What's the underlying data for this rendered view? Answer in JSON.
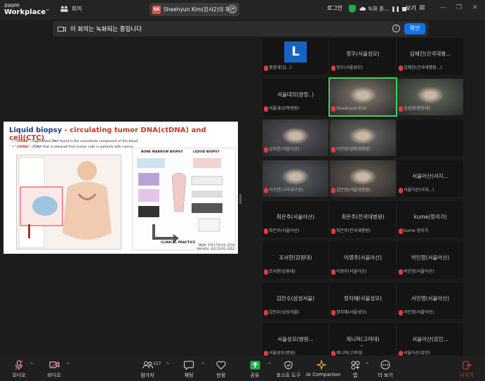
{
  "app": {
    "logo_line1": "zoom",
    "logo_line2": "Workplace"
  },
  "topbar": {
    "meeting_label": "회의",
    "share_initials": "SK",
    "share_title": "Sheehyun Kim(강사2)의 화면",
    "login_label": "로그인",
    "recording_label": "녹화 중...",
    "view_label": "보기"
  },
  "notice": {
    "text": "이 회의는 녹화되는 중입니다",
    "ok_label": "확인"
  },
  "slide": {
    "title_main": "Liquid biopsy",
    "title_sub": " - circulating tumor DNA(ctDNA) and cell(CTC)",
    "bullets": [
      {
        "term": "\"cfDNA\"",
        "text": ": fragmented DNA found in the noncellular component of the blood"
      },
      {
        "term": "\"ctDNA\"",
        "text": ": cfDNA that is released from tumor cells in patients with cancer"
      }
    ],
    "right_panel": {
      "left_heading": "BONE MARROW BIOPSY",
      "right_heading": "LIQUID BIOPSY",
      "footer": "CLINICAL PRACTICE"
    },
    "citation_1": "NEJM. 379:1754-65, 2018",
    "citation_2": "Hematol. 3(1):53-61, 2022"
  },
  "participants": [
    {
      "name": "",
      "sub": "중앙대(김...)",
      "avatar": "L",
      "video": false
    },
    {
      "name": "정우(서울성모)",
      "sub": "정우(서울성모)",
      "video": false
    },
    {
      "name": "김혜진(건국대병...",
      "sub": "김혜진(건국대병원...)",
      "video": false
    },
    {
      "name": "서울대의(양정..)",
      "sub": "서울대(강북병원)",
      "video": false
    },
    {
      "name": "",
      "sub": "Sheehyun Kim",
      "video": true,
      "active": true
    },
    {
      "name": "",
      "sub": "김경희(중앙대)",
      "video": true
    },
    {
      "name": "",
      "sub": "김지윤(서울아산)",
      "video": true
    },
    {
      "name": "",
      "sub": "이민정(경희대병원)",
      "video": true
    },
    {
      "name": "",
      "sub": "",
      "video": false
    },
    {
      "name": "",
      "sub": "이수연(고려대구로)",
      "video": true
    },
    {
      "name": "",
      "sub": "김은정(서울대병원)",
      "video": true
    },
    {
      "name": "서울아산(서지...",
      "sub": "서울아산(서지...)",
      "video": false
    },
    {
      "name": "최은주(서울아산)",
      "sub": "최은주(서울아산)",
      "video": false
    },
    {
      "name": "최은주(전국대병원)",
      "sub": "최은주(전국대병원)",
      "video": false
    },
    {
      "name": "kume(정리가)",
      "sub": "kume 정리가",
      "video": false
    },
    {
      "name": "조서현(강원대)",
      "sub": "조서현(강원대)",
      "video": false
    },
    {
      "name": "이영주(서울아산)",
      "sub": "이영주(서울아산)",
      "video": false
    },
    {
      "name": "박민정(서울아산)",
      "sub": "박민정(서울아산)",
      "video": false
    },
    {
      "name": "김민수(삼성서울)",
      "sub": "김민수(삼성서울)",
      "video": false
    },
    {
      "name": "정지혜(서울성모)",
      "sub": "정지혜(서울성모)",
      "video": false
    },
    {
      "name": "서민영(서울아산)",
      "sub": "서민영(서울아산)",
      "video": false
    },
    {
      "name": "서울성모(병원...",
      "sub": "서울성모(병원)",
      "video": false
    },
    {
      "name": "제니퍼(고려대)",
      "sub": "제니퍼(고려대)",
      "video": false
    },
    {
      "name": "서울아산(강인...",
      "sub": "서울아산(강인)",
      "video": false
    }
  ],
  "toolbar": {
    "audio": "오디오",
    "video": "비디오",
    "participants": "참가자",
    "participants_count": "117",
    "chat": "채팅",
    "react": "반응",
    "share": "공유",
    "host_tools": "호스트 도구",
    "ai_companion": "AI Companion",
    "apps": "앱",
    "more": "더 보기",
    "leave": "나가기"
  },
  "colors": {
    "accent": "#0e72ed",
    "active_speaker": "#3fd15b",
    "leave": "#e53935",
    "slide_title": "#1f3a7a"
  }
}
